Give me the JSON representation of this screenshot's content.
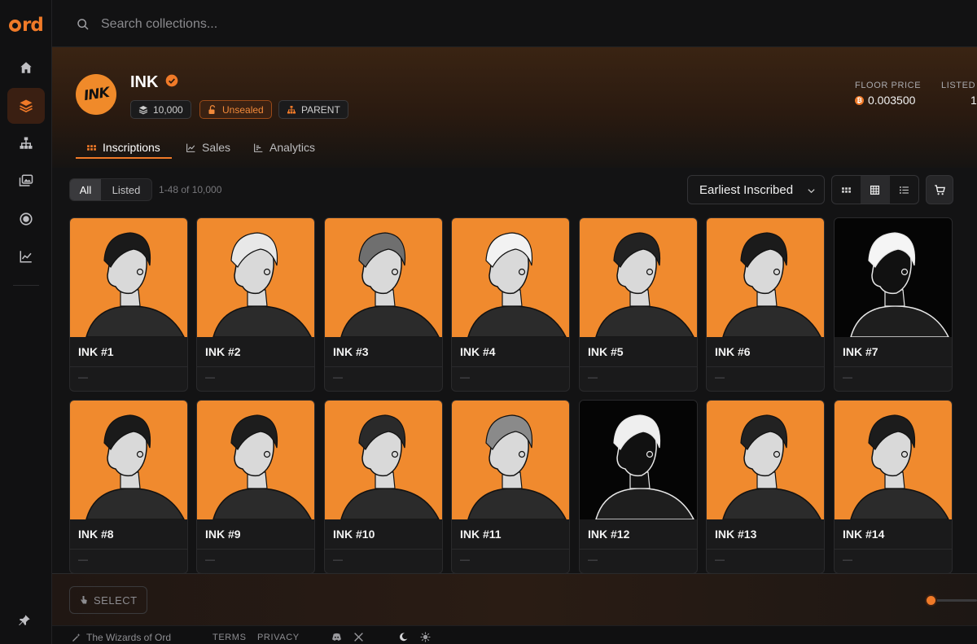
{
  "app": {
    "logo_text": "rd",
    "accent": "#f07a28"
  },
  "search": {
    "placeholder": "Search collections..."
  },
  "sidebar": {
    "items": [
      {
        "icon": "home-icon",
        "active": false
      },
      {
        "icon": "layers-icon",
        "active": true
      },
      {
        "icon": "sitemap-icon",
        "active": false
      },
      {
        "icon": "images-icon",
        "active": false
      },
      {
        "icon": "circle-dot-icon",
        "active": false
      },
      {
        "icon": "chart-line-icon",
        "active": false
      }
    ],
    "bottom_icon": "pin-icon"
  },
  "collection": {
    "avatar_text": "INK",
    "name": "INK",
    "verified": true,
    "chips": {
      "supply": "10,000",
      "status": "Unsealed",
      "type": "PARENT"
    },
    "stats": {
      "floor_label": "FLOOR PRICE",
      "floor_value": "0.003500",
      "listed_label": "LISTED",
      "listed_value": "1"
    }
  },
  "tabs": [
    {
      "label": "Inscriptions",
      "active": true
    },
    {
      "label": "Sales",
      "active": false
    },
    {
      "label": "Analytics",
      "active": false
    }
  ],
  "filters": {
    "all_label": "All",
    "listed_label": "Listed",
    "range_text": "1-48 of 10,000",
    "sort_value": "Earliest Inscribed"
  },
  "items": [
    {
      "name": "INK #1",
      "price": "—",
      "bg": "orange"
    },
    {
      "name": "INK #2",
      "price": "—",
      "bg": "orange"
    },
    {
      "name": "INK #3",
      "price": "—",
      "bg": "orange"
    },
    {
      "name": "INK #4",
      "price": "—",
      "bg": "orange"
    },
    {
      "name": "INK #5",
      "price": "—",
      "bg": "orange"
    },
    {
      "name": "INK #6",
      "price": "—",
      "bg": "orange"
    },
    {
      "name": "INK #7",
      "price": "—",
      "bg": "dark"
    },
    {
      "name": "INK #8",
      "price": "—",
      "bg": "orange"
    },
    {
      "name": "INK #9",
      "price": "—",
      "bg": "orange"
    },
    {
      "name": "INK #10",
      "price": "—",
      "bg": "orange"
    },
    {
      "name": "INK #11",
      "price": "—",
      "bg": "orange"
    },
    {
      "name": "INK #12",
      "price": "—",
      "bg": "dark"
    },
    {
      "name": "INK #13",
      "price": "—",
      "bg": "orange"
    },
    {
      "name": "INK #14",
      "price": "—",
      "bg": "orange"
    }
  ],
  "bottombar": {
    "select_label": "SELECT"
  },
  "footer": {
    "brand": "The Wizards of Ord",
    "terms": "TERMS",
    "privacy": "PRIVACY"
  }
}
